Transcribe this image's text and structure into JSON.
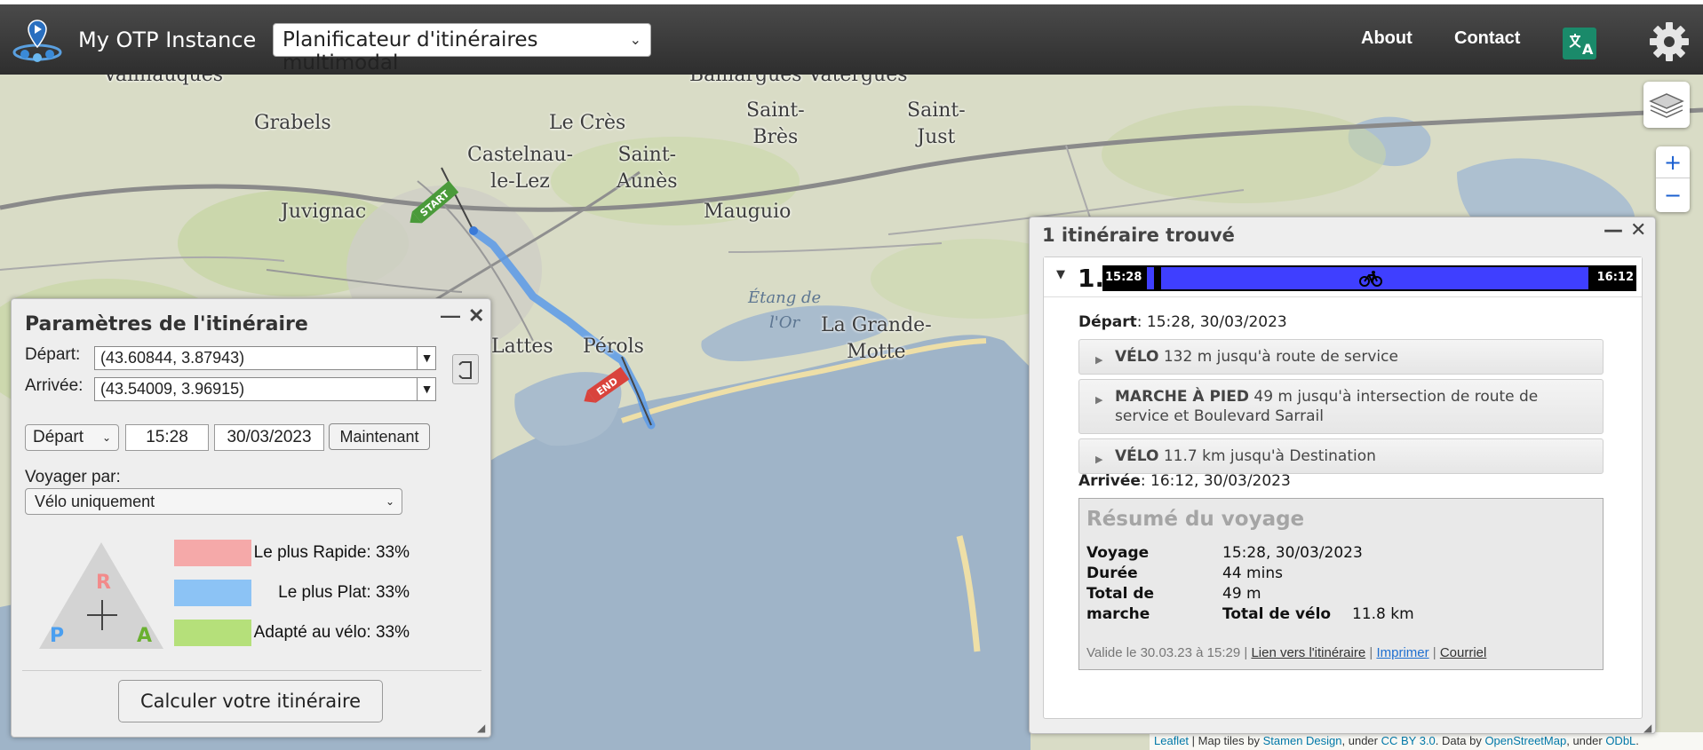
{
  "header": {
    "app_title": "My OTP Instance",
    "mode_selector": "Planificateur d'itinéraires multimodal",
    "nav": {
      "about": "About",
      "contact": "Contact"
    },
    "icons": [
      "otp-logo-icon",
      "language-icon",
      "gear-icon"
    ]
  },
  "map": {
    "towns": {
      "vailhauques": "Vailhauques",
      "baillargues": "Baillargues Vatergues",
      "grabels": "Grabels",
      "le_cres": "Le Crès",
      "saint_bres": "Saint-\nBrès",
      "saint_just": "Saint-\nJust",
      "castelnau": "Castelnau-\nle-Lez",
      "saint_aunes": "Saint-\nAunès",
      "juvignac": "Juvignac",
      "mauguio": "Mauguio",
      "etang_de_lor": "Étang de\nl'Or",
      "la_grande_motte": "La Grande-\nMotte",
      "lattes": "Lattes",
      "perols": "Pérols"
    },
    "markers": {
      "start": "START",
      "end": "END"
    },
    "zoom": {
      "in": "+",
      "out": "−"
    },
    "attribution": {
      "leaflet": "Leaflet",
      "sep1": " | Map tiles by ",
      "stamen": "Stamen Design",
      "sep2": ", under ",
      "ccby": "CC BY 3.0",
      "sep3": ". Data by ",
      "osm": "OpenStreetMap",
      "sep4": ", under ",
      "odbl": "ODbL",
      "end": "."
    }
  },
  "planner": {
    "title": "Paramètres de l'itinéraire",
    "minimize": "—",
    "close": "✕",
    "from_label": "Départ:",
    "from_value": "(43.60844, 3.87943)",
    "to_label": "Arrivée:",
    "to_value": "(43.54009, 3.96915)",
    "depart_type": "Départ",
    "time": "15:28",
    "date": "30/03/2023",
    "now_button": "Maintenant",
    "travel_label": "Voyager par:",
    "travel_mode": "Vélo uniquement",
    "triangle": {
      "r": "R",
      "p": "P",
      "a": "A"
    },
    "prefs": [
      {
        "label": "Le plus Rapide: 33%",
        "value": 33,
        "color": "#f5a9a9"
      },
      {
        "label": "Le plus Plat: 33%",
        "value": 33,
        "color": "#8cc3f5"
      },
      {
        "label": "Adapté au vélo: 33%",
        "value": 33,
        "color": "#b5e07a"
      }
    ],
    "plan_button": "Calculer votre itinéraire"
  },
  "results": {
    "title": "1 itinéraire trouvé",
    "minimize": "—",
    "close": "✕",
    "itinerary_number": "1.",
    "bar_start": "15:28",
    "bar_end": "16:12",
    "depart_label": "Départ",
    "depart_value": ": 15:28, 30/03/2023",
    "legs": [
      {
        "mode": "VÉLO",
        "text": " 132 m jusqu'à route de service"
      },
      {
        "mode": "MARCHE À PIED",
        "text": " 49 m jusqu'à intersection de route de service et Boulevard Sarrail"
      },
      {
        "mode": "VÉLO",
        "text": " 11.7 km jusqu'à Destination"
      }
    ],
    "arrive_label": "Arrivée",
    "arrive_value": ": 16:12, 30/03/2023",
    "summary": {
      "title": "Résumé du voyage",
      "voyage_key": "Voyage",
      "voyage_val": "15:28, 30/03/2023",
      "duree_key": "Durée",
      "duree_val": "44 mins",
      "marche_key_1": "Total de",
      "marche_key_2": "marche",
      "marche_val": "49 m",
      "velo_key": "Total de vélo",
      "velo_val": "11.8 km",
      "valid": "Valide le 30.03.23 à 15:29 | ",
      "link": "Lien vers l'itinéraire",
      "sep": " | ",
      "print": "Imprimer",
      "sep2": " | ",
      "email": "Courriel"
    }
  },
  "colors": {
    "header_bg": "#3a3a3a",
    "route": "#5a9ae8",
    "bar_bike": "#3f3fff",
    "start_flag": "#4a9a3a",
    "end_flag": "#d9433c"
  }
}
